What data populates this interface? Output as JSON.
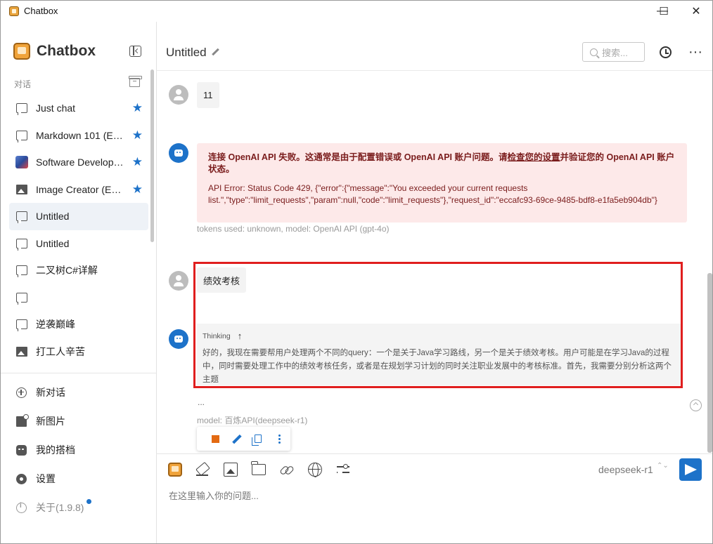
{
  "window": {
    "title": "Chatbox",
    "minimize": "—",
    "maximize": "☐",
    "close": "✕"
  },
  "sidebar": {
    "brand": "Chatbox",
    "section_label": "对话",
    "conversations": [
      {
        "label": "Just chat",
        "icon": "chat-icon",
        "starred": true
      },
      {
        "label": "Markdown 101 (E…",
        "icon": "chat-icon",
        "starred": true
      },
      {
        "label": "Software Develop…",
        "icon": "avatar-icon",
        "starred": true
      },
      {
        "label": "Image Creator (E…",
        "icon": "image-icon",
        "starred": true
      },
      {
        "label": "Untitled",
        "icon": "chat-icon",
        "starred": false,
        "active": true
      },
      {
        "label": "Untitled",
        "icon": "chat-icon",
        "starred": false
      },
      {
        "label": "二叉树C#详解",
        "icon": "chat-icon",
        "starred": false
      },
      {
        "label": "",
        "icon": "chat-icon",
        "starred": false
      },
      {
        "label": "逆袭巅峰",
        "icon": "chat-icon",
        "starred": false
      },
      {
        "label": "打工人辛苦",
        "icon": "image-icon",
        "starred": false
      }
    ],
    "menu": {
      "new_chat": "新对话",
      "new_image": "新图片",
      "my_copilots": "我的搭档",
      "settings": "设置",
      "about": "关于(1.9.8)"
    },
    "star_glyph": "★"
  },
  "header": {
    "title": "Untitled",
    "search_placeholder": "搜索..."
  },
  "messages": {
    "user1": "11",
    "error_title_pre": "连接 OpenAI API 失败。这通常是由于配置错误或 OpenAI API 账户问题。请",
    "error_title_link": "检查您的设置",
    "error_title_post": "并验证您的 OpenAI API 账户状态。",
    "error_detail": "API Error: Status Code 429, {\"error\":{\"message\":\"You exceeded your current requests list.\",\"type\":\"limit_requests\",\"param\":null,\"code\":\"limit_requests\"},\"request_id\":\"eccafc93-69ce-9485-bdf8-e1fa5eb904db\"}",
    "error_meta": "tokens used: unknown, model: OpenAI API (gpt-4o)",
    "user2": "绩效考核",
    "thinking_label": "Thinking",
    "thinking_arrow": "↑",
    "thinking_text": "好的，我现在需要帮用户处理两个不同的query：一个是关于Java学习路线，另一个是关于绩效考核。用户可能是在学习Java的过程中，同时需要处理工作中的绩效考核任务，或者是在规划学习计划的同时关注职业发展中的考核标准。首先，我需要分别分析这两个主题",
    "ellipsis": "...",
    "reply_meta": "model: 百炼API(deepseek-r1)"
  },
  "composer": {
    "model": "deepseek-r1",
    "model_caret": "⌃⌄",
    "placeholder": "在这里输入你的问题..."
  },
  "colors": {
    "accent": "#1d72c9",
    "error_bg": "#fde9e9",
    "highlight": "#e01e1e",
    "stop": "#e36a12"
  }
}
